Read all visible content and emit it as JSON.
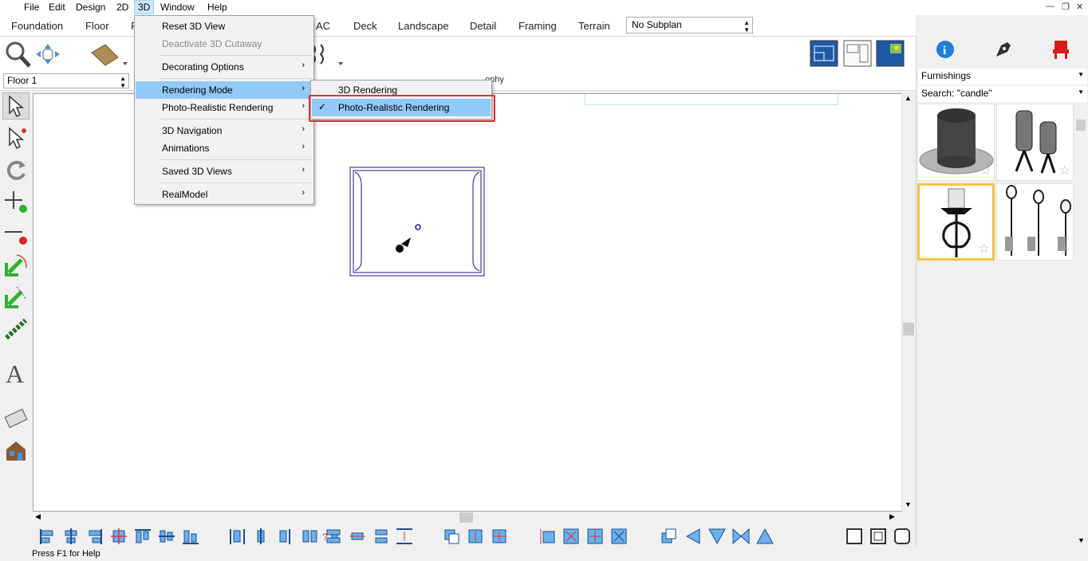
{
  "menubar": {
    "items": [
      "File",
      "Edit",
      "Design",
      "2D",
      "3D",
      "Window",
      "Help"
    ],
    "active": "3D"
  },
  "tabs": [
    "Foundation",
    "Floor",
    "F",
    "AC",
    "Deck",
    "Landscape",
    "Detail",
    "Framing",
    "Terrain"
  ],
  "subplan": {
    "value": "No Subplan"
  },
  "floor": {
    "value": "Floor 1"
  },
  "toolbar_partial_text": "ophy",
  "dropdown": {
    "items": [
      {
        "label": "Reset 3D View",
        "disabled": false,
        "submenu": false
      },
      {
        "label": "Deactivate 3D Cutaway",
        "disabled": true,
        "submenu": false
      },
      {
        "label": "Decorating Options",
        "disabled": false,
        "submenu": true
      },
      {
        "label": "Rendering Mode",
        "disabled": false,
        "submenu": true,
        "hover": true
      },
      {
        "label": "Photo-Realistic Rendering",
        "disabled": false,
        "submenu": true
      },
      {
        "label": "3D Navigation",
        "disabled": false,
        "submenu": true
      },
      {
        "label": "Animations",
        "disabled": false,
        "submenu": true
      },
      {
        "label": "Saved 3D Views",
        "disabled": false,
        "submenu": true
      },
      {
        "label": "RealModel",
        "disabled": false,
        "submenu": true
      }
    ]
  },
  "submenu": {
    "items": [
      {
        "label": "3D Rendering",
        "checked": false
      },
      {
        "label": "Photo-Realistic Rendering",
        "checked": true
      }
    ]
  },
  "right_panel": {
    "category": "Furnishings",
    "search": "Search: \"candle\""
  },
  "status": {
    "text": "Press F1 for Help"
  },
  "icons": {
    "checkmark": "✓",
    "submenu_arrow": "›",
    "dropdown_arrow": "▲▼",
    "star": "☆"
  },
  "colors": {
    "menu_hover": "#91c9f7",
    "highlight_box": "#e0303a",
    "selected_thumb": "#f5c542",
    "plan_line": "#1a1a8c"
  }
}
